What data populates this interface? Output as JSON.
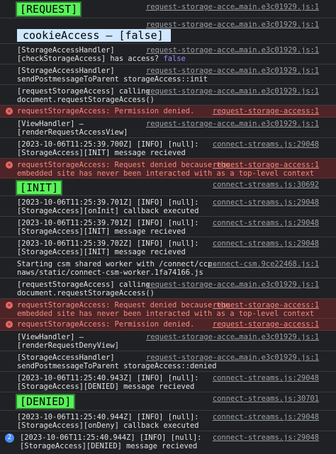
{
  "rows": {
    "r1": {
      "badge": "[REQUEST]",
      "src": "request-storage-acce…main.e3c01929.js:1"
    },
    "r2": {
      "src": "request-storage-acce…main.e3c01929.js:1"
    },
    "r2b": {
      "badge": "cookieAccess – [false]"
    },
    "r3": {
      "l1": "[StorageAccessHandler]",
      "l2": "[checkStorageAccess] has access?",
      "val": "false",
      "src": "request-storage-acce…main.e3c01929.js:1"
    },
    "r4": {
      "l1": "[StorageAccessHandler]",
      "l2": "sendPostmessageToParent storageAccess::init",
      "src": "request-storage-acce…main.e3c01929.js:1"
    },
    "r5": {
      "l1": "[requestStorageAccess] calling",
      "l2": "document.requestStorageAccess()",
      "src": "request-storage-acce…main.e3c01929.js:1"
    },
    "r6": {
      "l1": "requestStorageAccess: Permission denied.",
      "src": "request-storage-access:1"
    },
    "r7": {
      "l1": "[ViewHandler] –",
      "l2": "[renderRequestAccessView]",
      "src": "request-storage-acce…main.e3c01929.js:1"
    },
    "r8": {
      "l1": "[2023-10-06T11:25:39.700Z] [INFO] [null]:",
      "l2": "[StorageAccess][INIT] message recieved",
      "src": "connect-streams.js:29048"
    },
    "r9": {
      "l1": "requestStorageAccess: Request denied because the",
      "l2": "embedded site has never been interacted with as a top-level context",
      "src": "request-storage-access:1"
    },
    "r10": {
      "badge": "[INIT]",
      "src": "connect-streams.js:30692"
    },
    "r11": {
      "l1": "[2023-10-06T11:25:39.701Z] [INFO] [null]:",
      "l2": "[StorageAccess][onInit] callback executed",
      "src": "connect-streams.js:29048"
    },
    "r12": {
      "l1": "[2023-10-06T11:25:39.701Z] [INFO] [null]:",
      "l2": "[StorageAccess][INIT] message recieved",
      "src": "connect-streams.js:29048"
    },
    "r13": {
      "l1": "[2023-10-06T11:25:39.702Z] [INFO] [null]:",
      "l2": "[StorageAccess][INIT] message recieved",
      "src": "connect-streams.js:29048"
    },
    "r14": {
      "l1": "Starting csm shared worker with /connect/ccp-",
      "l2": "naws/static/connect-csm-worker.1fa74166.js",
      "src": "connect-csm.9ce22468.js:1"
    },
    "r15": {
      "l1": "[requestStorageAccess] calling",
      "l2": "document.requestStorageAccess()",
      "src": "request-storage-acce…main.e3c01929.js:1"
    },
    "r16": {
      "l1": "requestStorageAccess: Request denied because the",
      "l2": "embedded site has never been interacted with as a top-level context",
      "src": "request-storage-access:1"
    },
    "r17": {
      "l1": "requestStorageAccess: Permission denied.",
      "src": "request-storage-access:1"
    },
    "r18": {
      "l1": "[ViewHandler] –",
      "l2": "[renderRequestDenyView]",
      "src": "request-storage-acce…main.e3c01929.js:1"
    },
    "r19": {
      "l1": "[StorageAccessHandler]",
      "l2": "sendPostmessageToParent storageAccess::denied",
      "src": "request-storage-acce…main.e3c01929.js:1"
    },
    "r20": {
      "l1": "[2023-10-06T11:25:40.943Z] [INFO] [null]:",
      "l2": "[StorageAccess][DENIED] message recieved",
      "src": "connect-streams.js:29048"
    },
    "r21": {
      "badge": "[DENIED]",
      "src": "connect-streams.js:30701"
    },
    "r22": {
      "l1": "[2023-10-06T11:25:40.944Z] [INFO] [null]:",
      "l2": "[StorageAccess][onDeny] callback executed",
      "src": "connect-streams.js:29048"
    },
    "r23": {
      "count": "2",
      "l1": "[2023-10-06T11:25:40.944Z] [INFO] [null]:",
      "l2": "[StorageAccess][DENIED] message recieved",
      "src": "connect-streams.js:29048"
    }
  },
  "colors": {
    "background": "#202124",
    "badge_green": "#59f15a",
    "badge_blue": "#cfe8ff",
    "error_bg": "#4e2427",
    "error_text": "#f28b82"
  }
}
